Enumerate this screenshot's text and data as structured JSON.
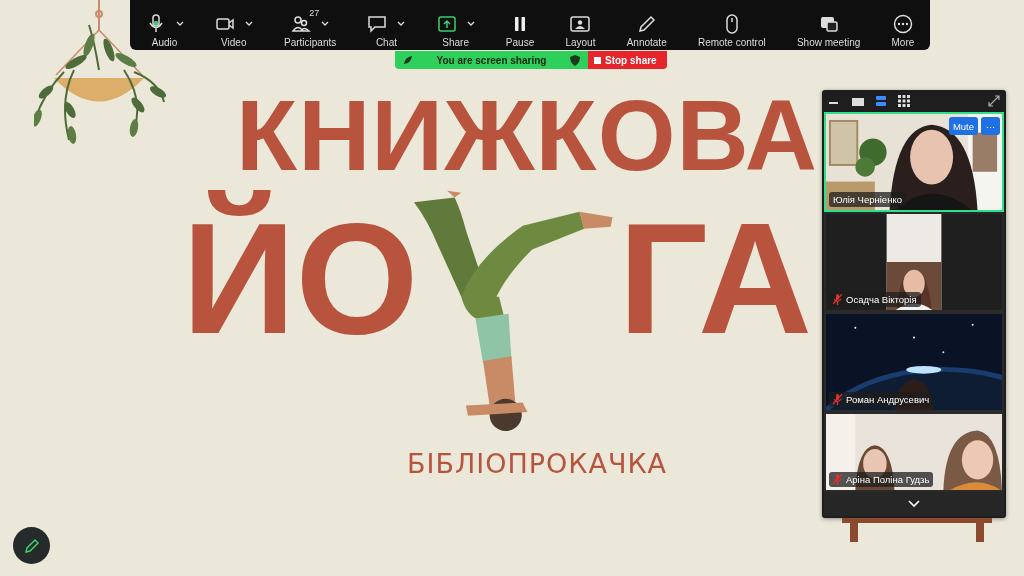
{
  "toolbar": {
    "items": [
      {
        "label": "Audio",
        "has_menu": true
      },
      {
        "label": "Video",
        "has_menu": true
      },
      {
        "label": "Participants",
        "has_menu": true,
        "count": "27"
      },
      {
        "label": "Chat",
        "has_menu": true
      },
      {
        "label": "Share",
        "has_menu": true,
        "active": true
      },
      {
        "label": "Pause",
        "has_menu": false
      },
      {
        "label": "Layout",
        "has_menu": false
      },
      {
        "label": "Annotate",
        "has_menu": false
      },
      {
        "label": "Remote control",
        "has_menu": false
      },
      {
        "label": "Show meeting",
        "has_menu": false
      },
      {
        "label": "More",
        "has_menu": false
      }
    ]
  },
  "sharing_bar": {
    "status": "You are screen sharing",
    "stop_button": "Stop share"
  },
  "slide": {
    "title_line_1": "КНИЖКОВА",
    "title_left": "ЙО",
    "title_right": "ГА",
    "subtitle": "БІБЛІОПРОКАЧКА"
  },
  "video_panel": {
    "views": [
      {
        "selected": false
      },
      {
        "selected": false
      },
      {
        "selected": true
      },
      {
        "selected": false
      }
    ],
    "tiles": [
      {
        "name": "Юлія Черніенко",
        "muted": false,
        "active": true,
        "mute_button": "Mute",
        "more_button": "···"
      },
      {
        "name": "Осадча Вікторія",
        "muted": true,
        "active": false
      },
      {
        "name": "Роман Андрусевич",
        "muted": true,
        "active": false
      },
      {
        "name": "Аріна Поліна Гудзь",
        "muted": true,
        "active": false
      }
    ]
  }
}
